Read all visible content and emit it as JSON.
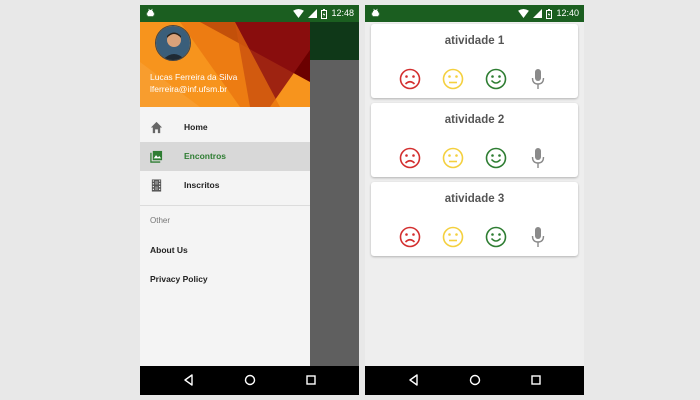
{
  "left_screen": {
    "status_time": "12:48",
    "user": {
      "name": "Lucas Ferreira da Silva",
      "email": "lferreira@inf.ufsm.br"
    },
    "menu_items": [
      {
        "label": "Home",
        "icon": "home-icon",
        "active": false
      },
      {
        "label": "Encontros",
        "icon": "photo-album-icon",
        "active": true
      },
      {
        "label": "Inscritos",
        "icon": "film-strip-icon",
        "active": false
      }
    ],
    "section_label": "Other",
    "extra_items": [
      "About Us",
      "Privacy Policy"
    ]
  },
  "right_screen": {
    "status_time": "12:40",
    "activities": [
      {
        "title": "atividade 1"
      },
      {
        "title": "atividade 2"
      },
      {
        "title": "atividade 3"
      }
    ]
  },
  "colors": {
    "status_bar": "#1b5e20",
    "accent_green": "#2e7d32",
    "header_orange": "#f7941d",
    "header_dark_red": "#6b0000",
    "sad_red": "#d32f2f",
    "neutral_yellow": "#f4d03f",
    "happy_green": "#2e7d32",
    "mic_gray": "#8a8a8a"
  }
}
